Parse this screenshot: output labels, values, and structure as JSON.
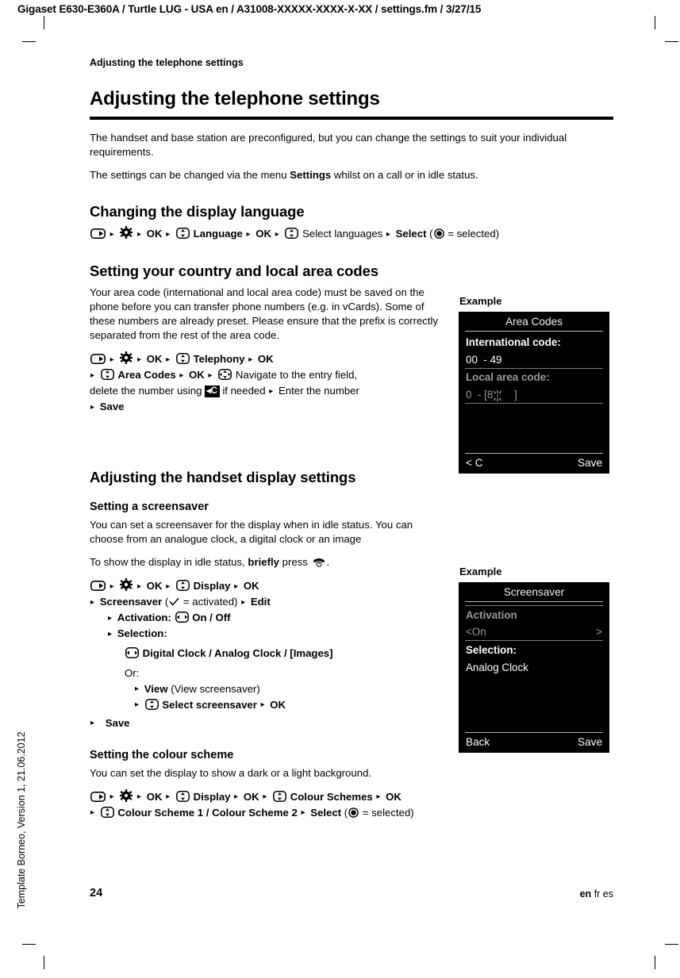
{
  "document": {
    "header_line": "Gigaset E630-E360A / Turtle LUG - USA en / A31008-XXXXX-XXXX-X-XX / settings.fm / 3/27/15",
    "template_label": "Template Borneo, Version 1, 21.06.2012",
    "running_head": "Adjusting the telephone settings",
    "page_number": "24",
    "language_current": "en",
    "language_others": "fr es"
  },
  "chapter": {
    "title": "Adjusting the telephone settings",
    "intro_1": "The handset and base station are preconfigured, but you can change the settings to suit your individual requirements.",
    "intro_2_pre": "The settings can be changed via the menu ",
    "intro_2_bold": "Settings",
    "intro_2_post": " whilst on a call or in idle status."
  },
  "sections": {
    "display_language": {
      "title": "Changing the display language",
      "path": {
        "ok_1": "OK",
        "item_1": "Language",
        "ok_2": "OK",
        "item_2": "Select languages",
        "select": "Select",
        "note": "( = selected)",
        "note_open": "(",
        "note_close": " = selected)"
      }
    },
    "area_codes": {
      "title": "Setting your country and local area codes",
      "body": "Your area code (international and local area code) must be saved on the phone before you can transfer phone numbers (e.g. in vCards). Some of these numbers are already preset. Please ensure that the prefix is correctly separated from the rest of the area code.",
      "path": {
        "ok_1": "OK",
        "item_1": "Telephony",
        "ok_2": "OK",
        "item_2": "Area Codes",
        "ok_3": "OK",
        "step_navigate": "Navigate to the entry field,",
        "step_delete_pre": "delete the number using ",
        "key_clear": "C",
        "step_delete_post": " if needed",
        "step_enter": "Enter the number",
        "save": "Save"
      },
      "example": {
        "label": "Example",
        "title": "Area Codes",
        "international_label": "International code:",
        "international_prefix": "00",
        "international_sep": "-",
        "international_value": "49",
        "local_label": "Local area code:",
        "local_prefix": "0",
        "local_sep": "-",
        "local_value": "[8",
        "local_close": "]",
        "softkey_left": "< C",
        "softkey_right": "Save"
      }
    },
    "handset_display": {
      "title": "Adjusting the handset display settings"
    },
    "screensaver": {
      "title": "Setting a screensaver",
      "body_1": "You can set a screensaver for the display when in idle status. You can choose from an analogue clock, a digital clock or an image",
      "body_2_pre": "To show the display in idle status, ",
      "body_2_bold": "briefly",
      "body_2_post": " press ",
      "body_2_end": ".",
      "path": {
        "ok_1": "OK",
        "item_display": "Display",
        "ok_2": "OK",
        "item_screensaver": "Screensaver",
        "activated_note_open": "(",
        "activated_note_close": " = activated)",
        "edit": "Edit",
        "activation_label": "Activation:",
        "activation_values": "On / Off",
        "selection_label": "Selection:",
        "selection_values": "Digital Clock / Analog Clock / [Images]",
        "or": "Or:",
        "view": "View",
        "view_note": "(View screensaver)",
        "select_screensaver": "Select screensaver",
        "ok_3": "OK",
        "save": "Save"
      },
      "example": {
        "label": "Example",
        "title": "Screensaver",
        "activation_label": "Activation",
        "activation_left": "<On",
        "activation_right": ">",
        "selection_label": "Selection:",
        "selection_value": "Analog Clock",
        "softkey_left": "Back",
        "softkey_right": "Save"
      }
    },
    "colour_scheme": {
      "title": "Setting the colour scheme",
      "body": "You can set the display to show a dark or a light background.",
      "path": {
        "ok_1": "OK",
        "item_display": "Display",
        "ok_2": "OK",
        "item_schemes": "Colour Schemes",
        "ok_3": "OK",
        "values": "Colour Scheme 1 / Colour Scheme 2",
        "select": "Select",
        "note_open": "(",
        "note_close": " = selected)"
      }
    }
  },
  "icons": {
    "display_key": "display-key-icon",
    "settings_gear": "settings-gear-icon",
    "nav_updown": "nav-updown-icon",
    "nav_leftright": "nav-leftright-icon",
    "nav_multi": "nav-multidirection-icon",
    "radio_selected": "radio-selected-icon",
    "check": "check-icon",
    "end_call": "end-call-key-icon",
    "cursor": "blinking-cursor-icon"
  }
}
